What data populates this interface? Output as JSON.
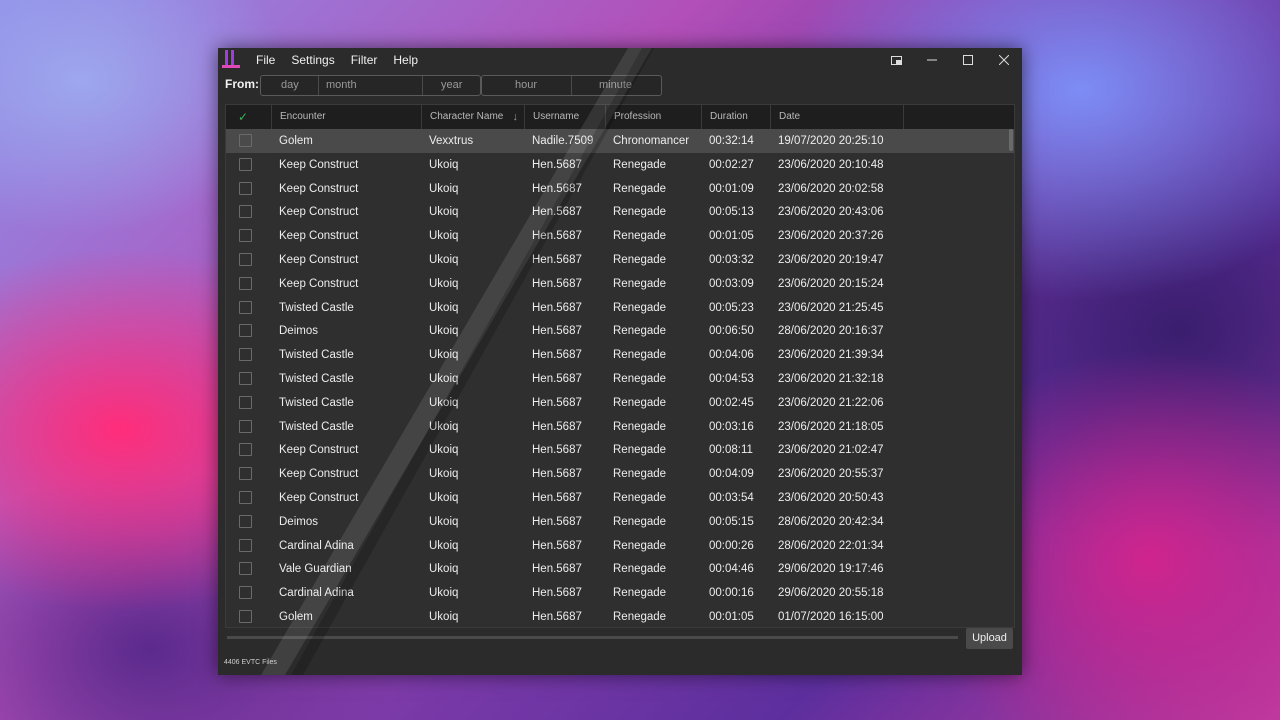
{
  "menu": {
    "file": "File",
    "settings": "Settings",
    "filter": "Filter",
    "help": "Help"
  },
  "from": {
    "label": "From:",
    "day_placeholder": "day",
    "month_placeholder": "month",
    "year_placeholder": "year",
    "hour_placeholder": "hour",
    "minute_placeholder": "minute"
  },
  "table": {
    "columns": {
      "check": "✓",
      "encounter": "Encounter",
      "character_name": "Character Name",
      "username": "Username",
      "profession": "Profession",
      "duration": "Duration",
      "date": "Date"
    },
    "sort_icon": "↓",
    "rows": [
      {
        "encounter": "Golem",
        "character": "Vexxtrus",
        "username": "Nadile.7509",
        "profession": "Chronomancer",
        "duration": "00:32:14",
        "date": "19/07/2020 20:25:10"
      },
      {
        "encounter": "Keep Construct",
        "character": "Ukoiq",
        "username": "Hen.5687",
        "profession": "Renegade",
        "duration": "00:02:27",
        "date": "23/06/2020 20:10:48"
      },
      {
        "encounter": "Keep Construct",
        "character": "Ukoiq",
        "username": "Hen.5687",
        "profession": "Renegade",
        "duration": "00:01:09",
        "date": "23/06/2020 20:02:58"
      },
      {
        "encounter": "Keep Construct",
        "character": "Ukoiq",
        "username": "Hen.5687",
        "profession": "Renegade",
        "duration": "00:05:13",
        "date": "23/06/2020 20:43:06"
      },
      {
        "encounter": "Keep Construct",
        "character": "Ukoiq",
        "username": "Hen.5687",
        "profession": "Renegade",
        "duration": "00:01:05",
        "date": "23/06/2020 20:37:26"
      },
      {
        "encounter": "Keep Construct",
        "character": "Ukoiq",
        "username": "Hen.5687",
        "profession": "Renegade",
        "duration": "00:03:32",
        "date": "23/06/2020 20:19:47"
      },
      {
        "encounter": "Keep Construct",
        "character": "Ukoiq",
        "username": "Hen.5687",
        "profession": "Renegade",
        "duration": "00:03:09",
        "date": "23/06/2020 20:15:24"
      },
      {
        "encounter": "Twisted Castle",
        "character": "Ukoiq",
        "username": "Hen.5687",
        "profession": "Renegade",
        "duration": "00:05:23",
        "date": "23/06/2020 21:25:45"
      },
      {
        "encounter": "Deimos",
        "character": "Ukoiq",
        "username": "Hen.5687",
        "profession": "Renegade",
        "duration": "00:06:50",
        "date": "28/06/2020 20:16:37"
      },
      {
        "encounter": "Twisted Castle",
        "character": "Ukoiq",
        "username": "Hen.5687",
        "profession": "Renegade",
        "duration": "00:04:06",
        "date": "23/06/2020 21:39:34"
      },
      {
        "encounter": "Twisted Castle",
        "character": "Ukoiq",
        "username": "Hen.5687",
        "profession": "Renegade",
        "duration": "00:04:53",
        "date": "23/06/2020 21:32:18"
      },
      {
        "encounter": "Twisted Castle",
        "character": "Ukoiq",
        "username": "Hen.5687",
        "profession": "Renegade",
        "duration": "00:02:45",
        "date": "23/06/2020 21:22:06"
      },
      {
        "encounter": "Twisted Castle",
        "character": "Ukoiq",
        "username": "Hen.5687",
        "profession": "Renegade",
        "duration": "00:03:16",
        "date": "23/06/2020 21:18:05"
      },
      {
        "encounter": "Keep Construct",
        "character": "Ukoiq",
        "username": "Hen.5687",
        "profession": "Renegade",
        "duration": "00:08:11",
        "date": "23/06/2020 21:02:47"
      },
      {
        "encounter": "Keep Construct",
        "character": "Ukoiq",
        "username": "Hen.5687",
        "profession": "Renegade",
        "duration": "00:04:09",
        "date": "23/06/2020 20:55:37"
      },
      {
        "encounter": "Keep Construct",
        "character": "Ukoiq",
        "username": "Hen.5687",
        "profession": "Renegade",
        "duration": "00:03:54",
        "date": "23/06/2020 20:50:43"
      },
      {
        "encounter": "Deimos",
        "character": "Ukoiq",
        "username": "Hen.5687",
        "profession": "Renegade",
        "duration": "00:05:15",
        "date": "28/06/2020 20:42:34"
      },
      {
        "encounter": "Cardinal Adina",
        "character": "Ukoiq",
        "username": "Hen.5687",
        "profession": "Renegade",
        "duration": "00:00:26",
        "date": "28/06/2020 22:01:34"
      },
      {
        "encounter": "Vale Guardian",
        "character": "Ukoiq",
        "username": "Hen.5687",
        "profession": "Renegade",
        "duration": "00:04:46",
        "date": "29/06/2020 19:17:46"
      },
      {
        "encounter": "Cardinal Adina",
        "character": "Ukoiq",
        "username": "Hen.5687",
        "profession": "Renegade",
        "duration": "00:00:16",
        "date": "29/06/2020 20:55:18"
      },
      {
        "encounter": "Golem",
        "character": "Ukoiq",
        "username": "Hen.5687",
        "profession": "Renegade",
        "duration": "00:01:05",
        "date": "01/07/2020 16:15:00"
      }
    ]
  },
  "upload_label": "Upload",
  "status_text": "4406 EVTC Files",
  "colors": {
    "accent_purple": "#a23be0",
    "accent_pink": "#e04ab8",
    "check_green": "#3fae5b"
  }
}
